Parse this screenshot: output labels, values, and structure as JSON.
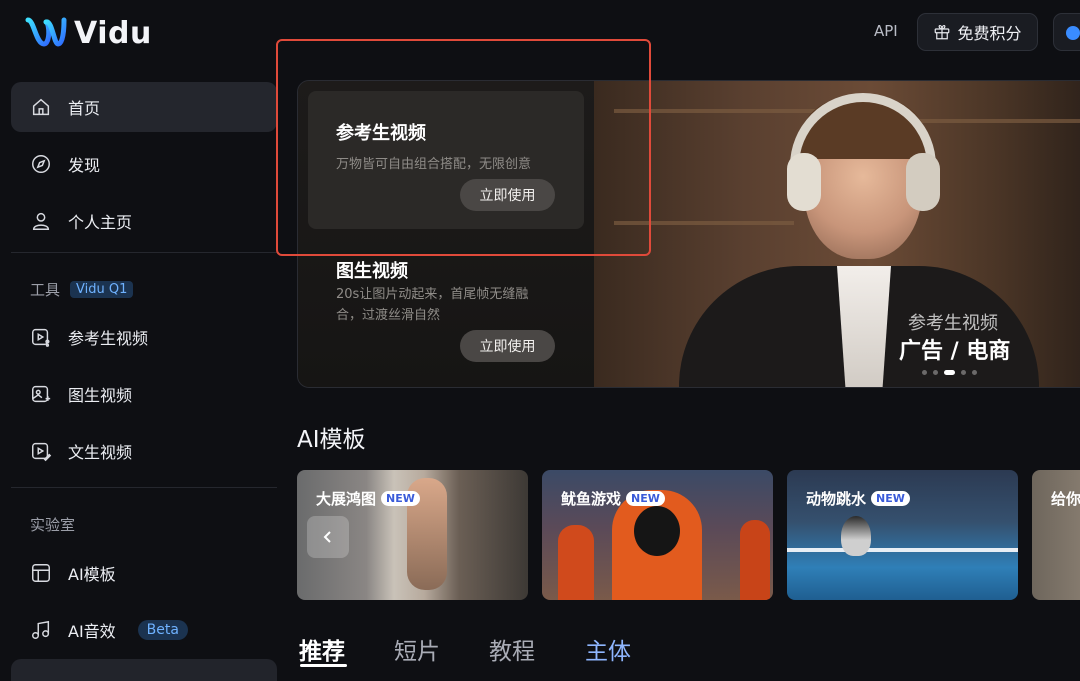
{
  "app": {
    "name": "Vidu"
  },
  "topbar": {
    "api_label": "API",
    "credits_label": "免费积分"
  },
  "sidebar": {
    "nav": [
      {
        "label": "首页",
        "icon": "home-icon"
      },
      {
        "label": "发现",
        "icon": "compass-icon"
      },
      {
        "label": "个人主页",
        "icon": "user-icon"
      }
    ],
    "tools_label": "工具",
    "tools_tag": "Vidu Q1",
    "tools": [
      {
        "label": "参考生视频",
        "icon": "reference-video-icon"
      },
      {
        "label": "图生视频",
        "icon": "image-video-icon"
      },
      {
        "label": "文生视频",
        "icon": "text-video-icon"
      }
    ],
    "lab_label": "实验室",
    "lab": [
      {
        "label": "AI模板",
        "icon": "template-icon"
      },
      {
        "label": "AI音效",
        "icon": "music-icon",
        "badge": "Beta"
      }
    ]
  },
  "hero": {
    "card1": {
      "title": "参考生视频",
      "desc": "万物皆可自由组合搭配，无限创意",
      "button": "立即使用"
    },
    "card2": {
      "title": "图生视频",
      "desc_line1": "20s让图片动起来，首尾帧无缝融",
      "desc_line2": "合，过渡丝滑自然",
      "button": "立即使用"
    },
    "caption_small": "参考生视频",
    "caption_big": "广告 / 电商",
    "slides": 5,
    "active_slide": 3
  },
  "templates": {
    "title": "AI模板",
    "new_badge": "NEW",
    "items": [
      {
        "label": "大展鸿图",
        "is_new": true
      },
      {
        "label": "鱿鱼游戏",
        "is_new": true
      },
      {
        "label": "动物跳水",
        "is_new": true
      },
      {
        "label": "给你"
      }
    ]
  },
  "tabs": [
    "推荐",
    "短片",
    "教程",
    "主体"
  ],
  "colors": {
    "accent": "#6fb2ff",
    "highlight_box": "#e04a3a",
    "background": "#0e0f13"
  }
}
